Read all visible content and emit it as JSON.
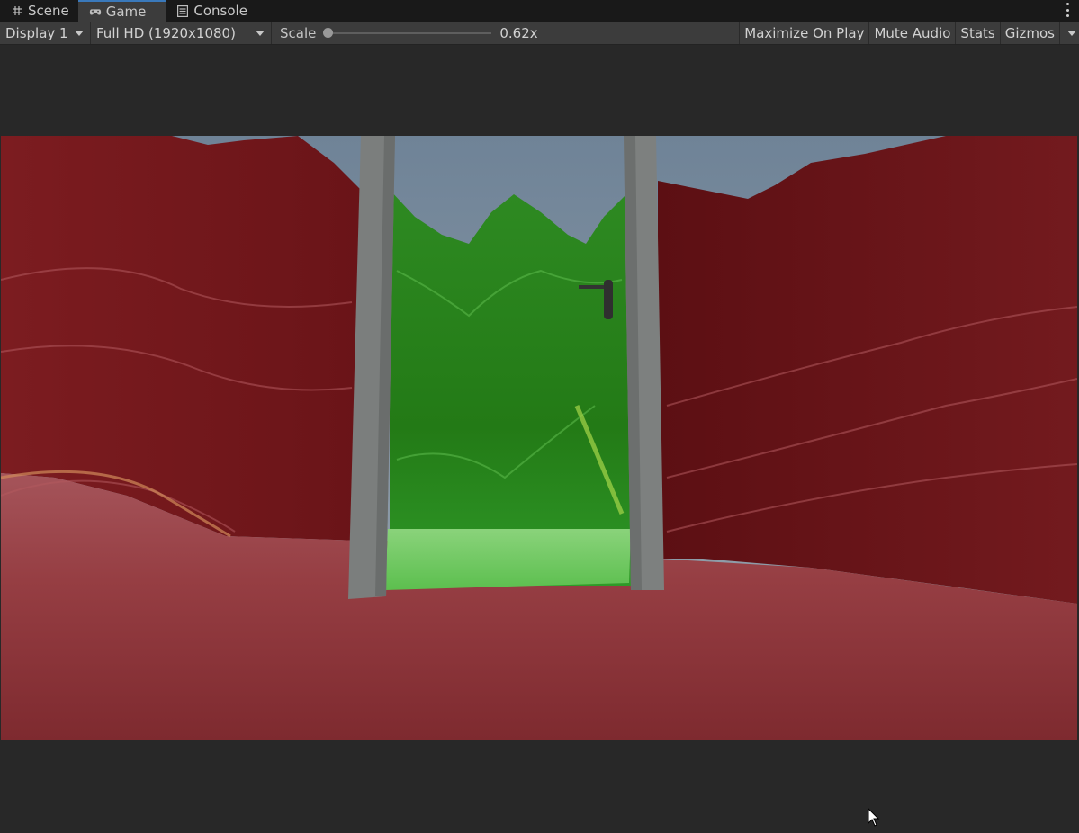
{
  "tabs": [
    {
      "label": "Scene",
      "icon": "hash-icon",
      "active": false
    },
    {
      "label": "Game",
      "icon": "gamepad-icon",
      "active": true
    },
    {
      "label": "Console",
      "icon": "console-list-icon",
      "active": false
    }
  ],
  "toolbar": {
    "display": "Display 1",
    "resolution": "Full HD (1920x1080)",
    "scale_label": "Scale",
    "scale_value": "0.62x",
    "scale_fraction": 0.0,
    "maximize_label": "Maximize On Play",
    "mute_label": "Mute Audio",
    "stats_label": "Stats",
    "gizmos_label": "Gizmos"
  },
  "colors": {
    "tab_accent": "#3a79bb",
    "terrain_red": "#7a1a1a",
    "terrain_green": "#2f8a20",
    "door_frame": "#7a7d7c",
    "sky": "#7b8d9e"
  }
}
